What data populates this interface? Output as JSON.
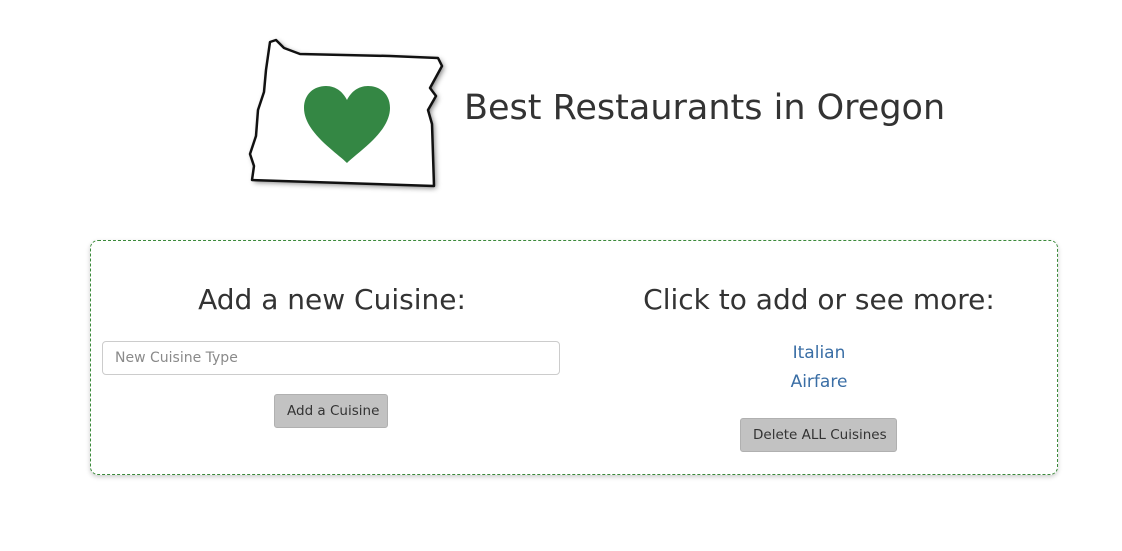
{
  "header": {
    "title": "Best Restaurants in Oregon",
    "logo_icon": "oregon-heart-logo",
    "logo_heart_color": "#348744"
  },
  "add_section": {
    "heading": "Add a new Cuisine:",
    "input_value": "",
    "input_placeholder": "New Cuisine Type",
    "add_button_label": "Add a Cuisine"
  },
  "list_section": {
    "heading": "Click to add or see more:",
    "cuisines": [
      {
        "label": "Italian"
      },
      {
        "label": "Airfare"
      }
    ],
    "delete_button_label": "Delete ALL Cuisines"
  },
  "colors": {
    "panel_border": "#3a8a3a",
    "link": "#3a6ea5",
    "button_bg": "#c2c2c2"
  }
}
